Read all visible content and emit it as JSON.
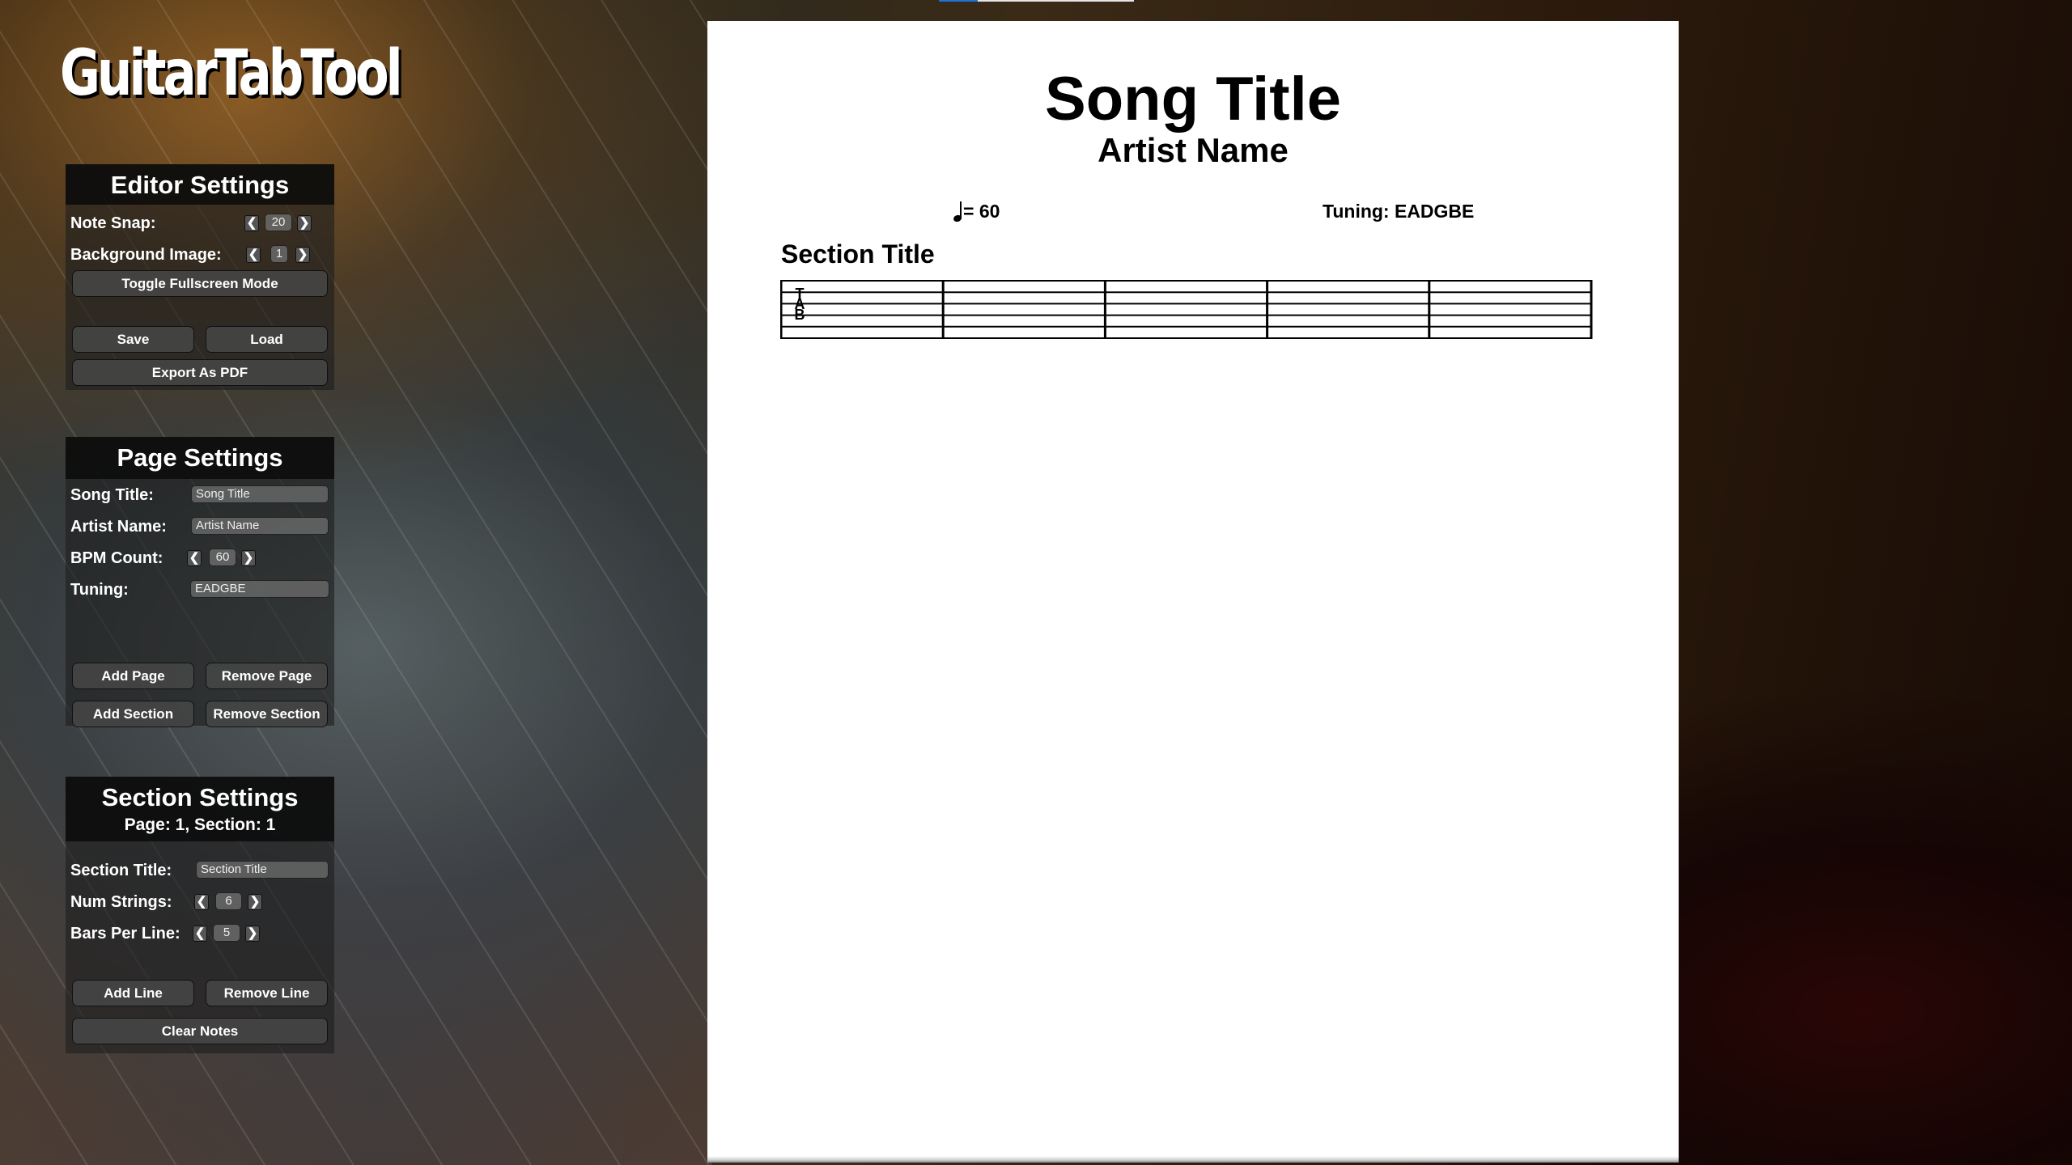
{
  "app": {
    "logo": "GuitarTabTool",
    "load_progress": 0.2
  },
  "editor_settings": {
    "title": "Editor Settings",
    "note_snap": {
      "label": "Note Snap:",
      "value": "20"
    },
    "background_image": {
      "label": "Background Image:",
      "value": "1"
    },
    "toggle_fullscreen": "Toggle Fullscreen Mode",
    "save": "Save",
    "load": "Load",
    "export_pdf": "Export As PDF"
  },
  "page_settings": {
    "title": "Page Settings",
    "song_title": {
      "label": "Song Title:",
      "value": "Song Title"
    },
    "artist_name": {
      "label": "Artist Name:",
      "value": "Artist Name"
    },
    "bpm_count": {
      "label": "BPM Count:",
      "value": "60"
    },
    "tuning": {
      "label": "Tuning:",
      "value": "EADGBE"
    },
    "add_page": "Add Page",
    "remove_page": "Remove Page",
    "add_section": "Add Section",
    "remove_section": "Remove Section"
  },
  "section_settings": {
    "title": "Section Settings",
    "subtitle": "Page: 1, Section: 1",
    "section_title": {
      "label": "Section Title:",
      "value": "Section Title"
    },
    "num_strings": {
      "label": "Num Strings:",
      "value": "6"
    },
    "bars_per_line": {
      "label": "Bars Per Line:",
      "value": "5"
    },
    "add_line": "Add Line",
    "remove_line": "Remove Line",
    "clear_notes": "Clear Notes"
  },
  "stepper": {
    "prev_glyph": "❮",
    "next_glyph": "❯"
  },
  "sheet": {
    "song_title": "Song Title",
    "artist_name": "Artist Name",
    "tempo": "= 60",
    "tuning": "Tuning: EADGBE",
    "sections": [
      {
        "title": "Section Title",
        "tab_clef": [
          "T",
          "A",
          "B"
        ],
        "num_strings": 6,
        "bars": 5
      }
    ]
  }
}
